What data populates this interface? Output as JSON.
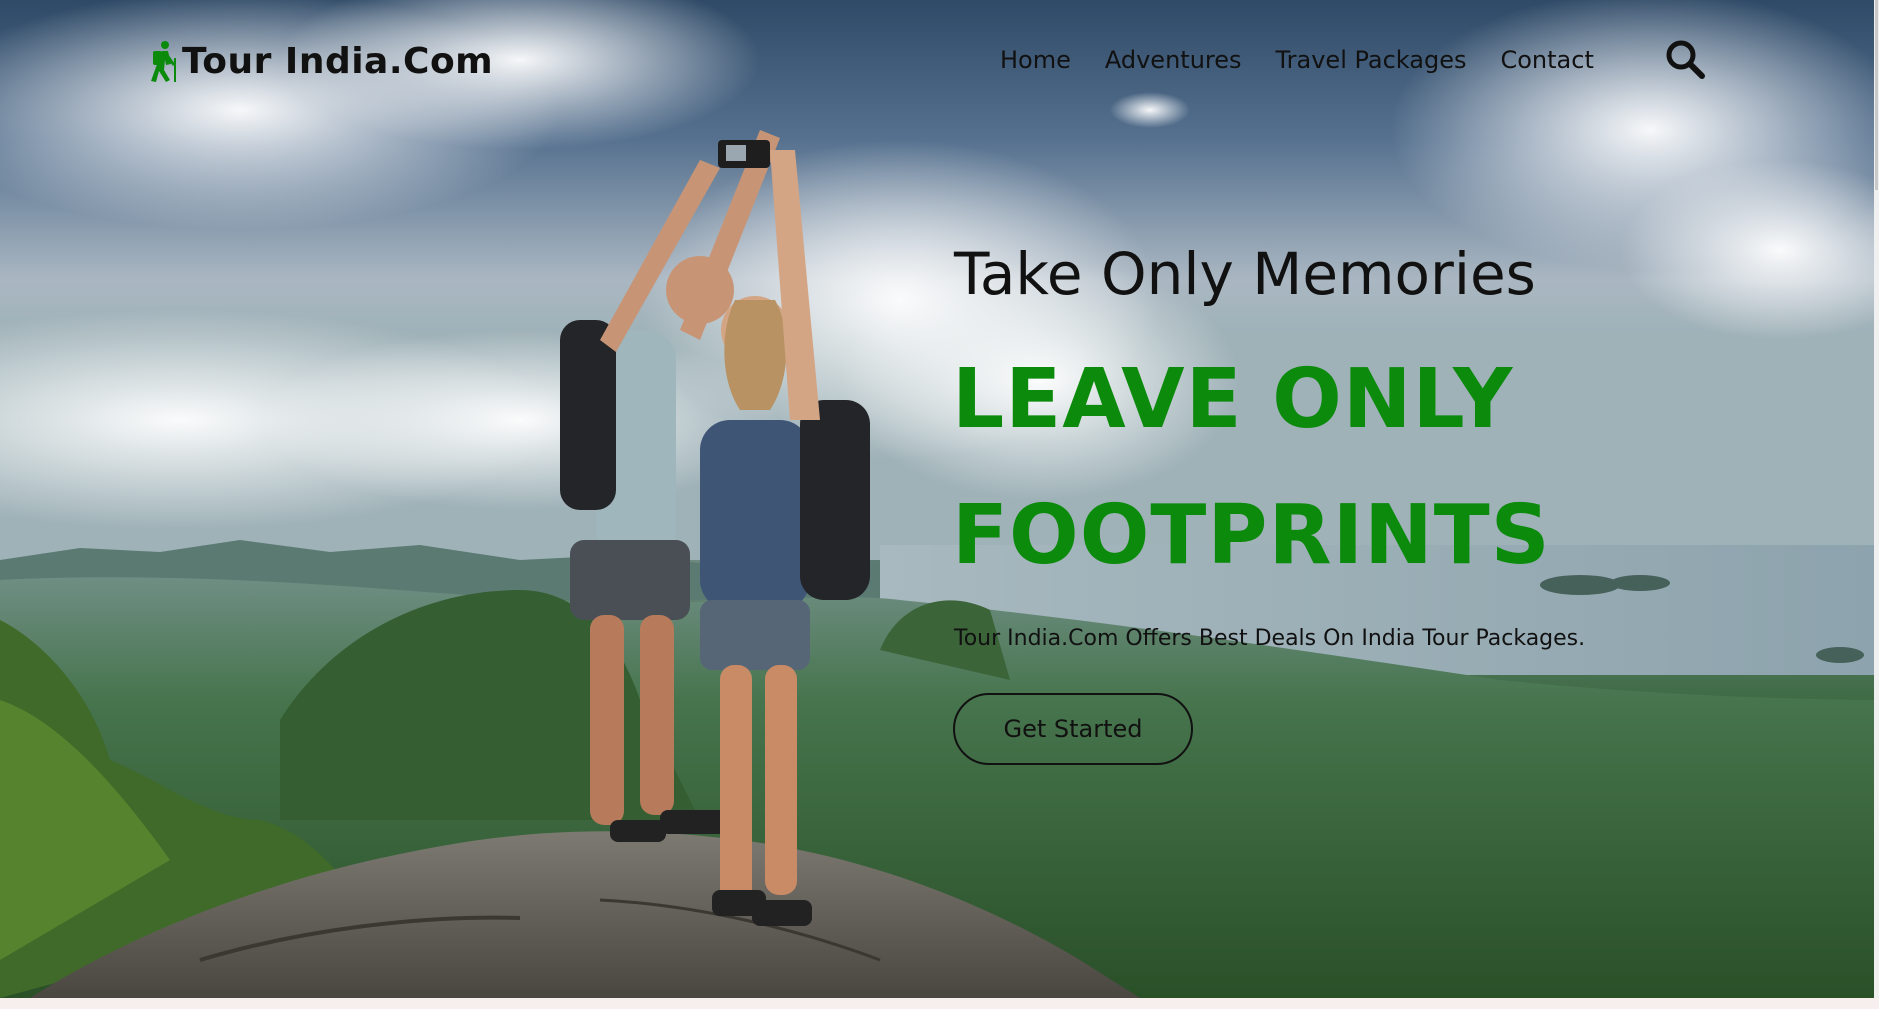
{
  "brand": {
    "name": "Tour India.Com",
    "icon": "hiker-icon",
    "icon_color": "#0b8a0b"
  },
  "nav": {
    "items": [
      {
        "label": "Home"
      },
      {
        "label": "Adventures"
      },
      {
        "label": "Travel Packages"
      },
      {
        "label": "Contact"
      }
    ],
    "search_icon": "search-icon"
  },
  "hero": {
    "headline": "Take Only Memories",
    "big_line_1": "LEAVE ONLY",
    "big_line_2": "FOOTPRINTS",
    "tagline": "Tour India.Com Offers Best Deals On India Tour Packages.",
    "cta_label": "Get Started",
    "accent_color": "#0b8a0b",
    "background": "photo-couple-selfie-mountain-top"
  }
}
